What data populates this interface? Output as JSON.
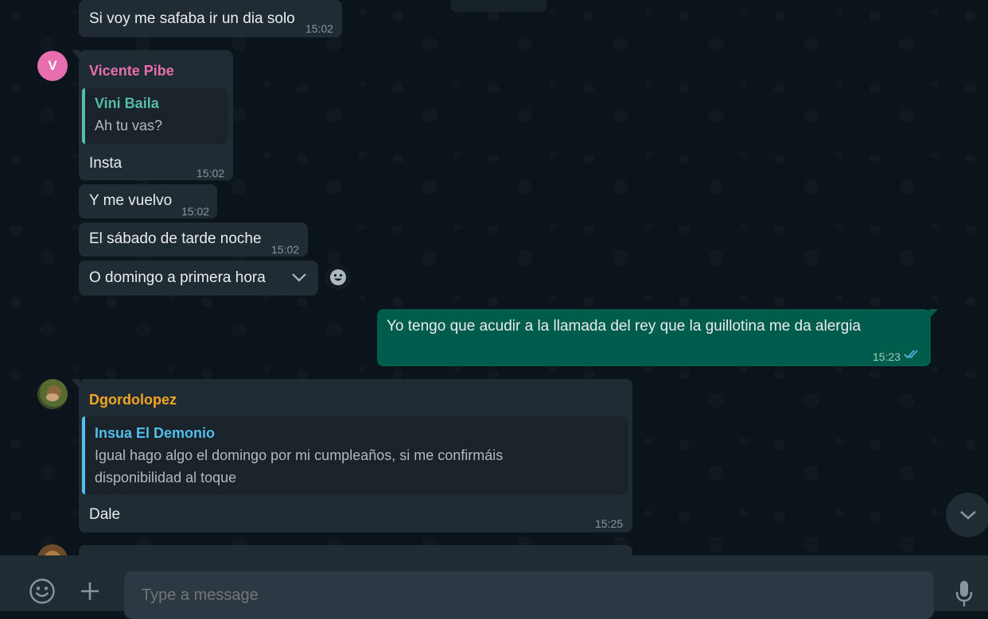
{
  "messages": [
    {
      "text": "Si voy me safaba ir un dia solo",
      "time": "15:02"
    },
    {
      "sender": "Vicente Pibe",
      "avatar_letter": "V",
      "quote_name": "Vini Baila",
      "quote_text": "Ah tu vas?",
      "text": "Insta",
      "time": "15:02"
    },
    {
      "text": "Y me vuelvo",
      "time": "15:02"
    },
    {
      "text": "El sábado de tarde noche",
      "time": "15:02"
    },
    {
      "text": "O domingo a primera hora"
    },
    {
      "text": "Yo tengo que acudir a la llamada del rey que la guillotina me da alergia",
      "time": "15:23"
    },
    {
      "sender": "Dgordolopez",
      "quote_name": "Insua El Demonio",
      "quote_line1": "Igual hago algo el domingo por mi cumpleaños, si me confirmáis",
      "quote_line2": "disponibilidad al toque",
      "text": "Dale",
      "time": "15:25"
    }
  ],
  "footer": {
    "placeholder": "Type a message"
  },
  "icons": {
    "message_menu": "chevron-down-icon",
    "react": "emoji-icon",
    "scroll_down": "chevron-down-icon",
    "emoji": "emoji-icon",
    "attach": "plus-icon",
    "mic": "mic-icon",
    "read_receipt": "double-check-icon"
  },
  "colors": {
    "incoming_bubble": "#202c33",
    "outgoing_bubble": "#005c4b",
    "sender_vicente": "#e86eb0",
    "sender_dgordo": "#f5a623",
    "quote_vini": "#53bdaa",
    "quote_insua": "#53bdeb",
    "read_ticks": "#53bdeb"
  }
}
